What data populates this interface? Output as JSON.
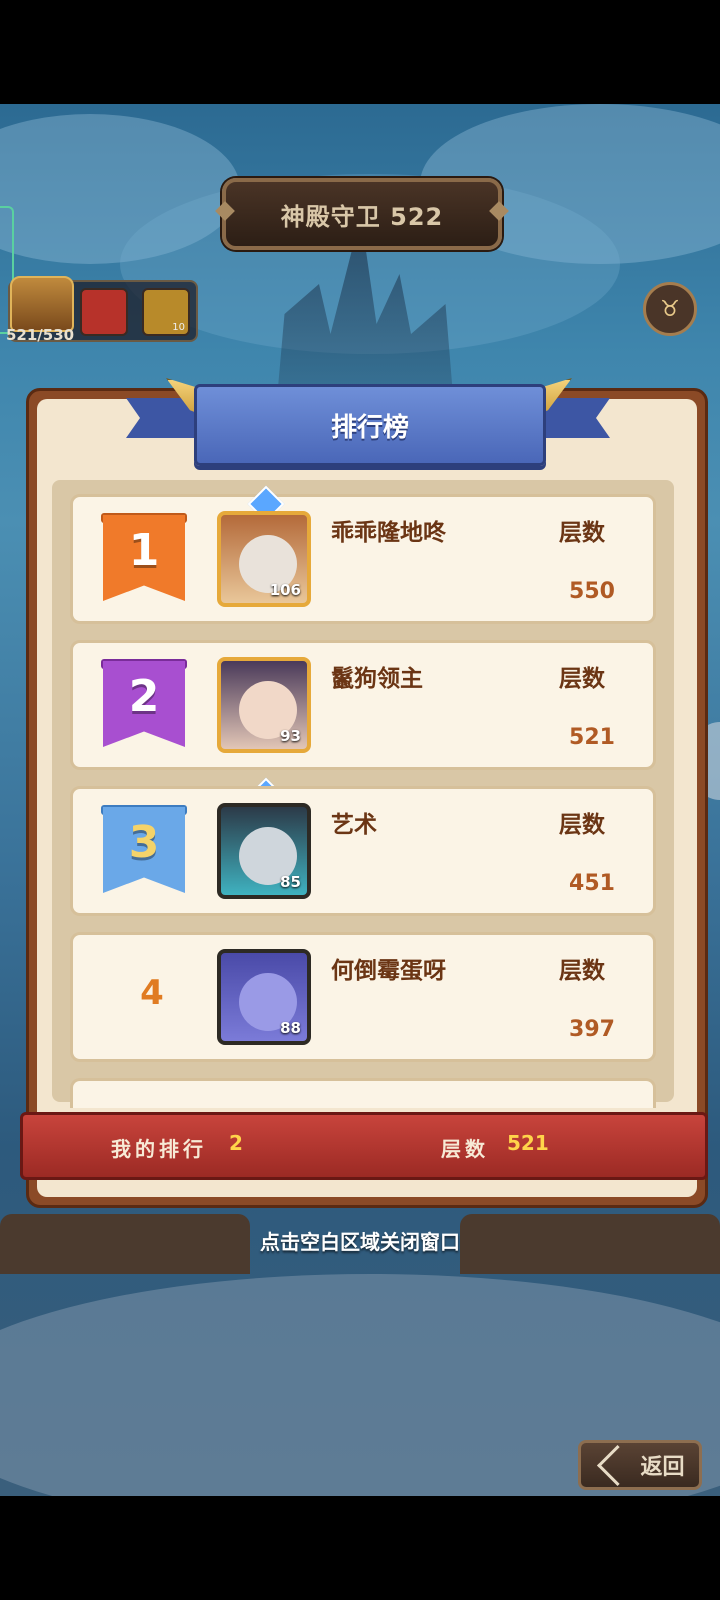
{
  "header": {
    "title": "神殿守卫 522"
  },
  "resources": {
    "chest_count": "521/530",
    "items": [
      {
        "icon": "scroll-icon",
        "qty": ""
      },
      {
        "icon": "coin-icon",
        "qty": "10"
      }
    ]
  },
  "panel": {
    "title": "排行榜"
  },
  "rankings": [
    {
      "rank": "1",
      "name": "乖乖隆地咚",
      "level": "106",
      "label": "层数",
      "value": "550",
      "flag_color": "#f07a2a"
    },
    {
      "rank": "2",
      "name": "鬣狗领主",
      "level": "93",
      "label": "层数",
      "value": "521",
      "flag_color": "#a84fd0"
    },
    {
      "rank": "3",
      "name": "艺术",
      "level": "85",
      "label": "层数",
      "value": "451",
      "flag_color": "#6aa8e8"
    },
    {
      "rank": "4",
      "name": "何倒霉蛋呀",
      "level": "88",
      "label": "层数",
      "value": "397",
      "flag_color": ""
    }
  ],
  "my_rank": {
    "rank_label": "我的排行",
    "rank_value": "2",
    "floors_label": "层数",
    "floors_value": "521"
  },
  "hint": "点击空白区域关闭窗口",
  "back_button": {
    "label": "返回"
  }
}
